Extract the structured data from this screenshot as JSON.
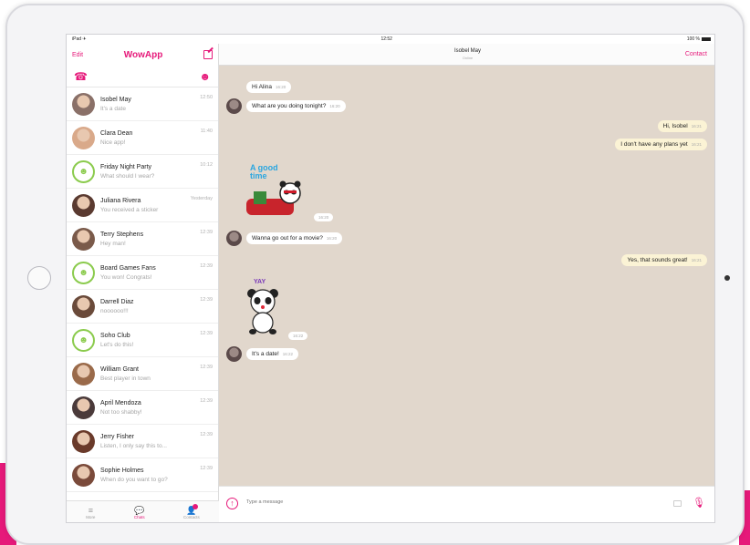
{
  "statusbar": {
    "carrier": "iPad ✈",
    "time": "12:52",
    "battery": "100 %"
  },
  "sidebar": {
    "edit_label": "Edit",
    "app_title": "WowApp",
    "chats": [
      {
        "name": "Isobel May",
        "preview": "It's a date",
        "time": "12:50",
        "avatar_color": "#8a7068",
        "group": false
      },
      {
        "name": "Clara Dean",
        "preview": "Nice app!",
        "time": "11:40",
        "avatar_color": "#d9a98a",
        "group": false
      },
      {
        "name": "Friday Night Party",
        "preview": "What should I wear?",
        "time": "10:12",
        "avatar_color": "#8bcb4d",
        "group": true
      },
      {
        "name": "Juliana Rivera",
        "preview": "You received a sticker",
        "time": "Yesterday",
        "avatar_color": "#5a3a30",
        "group": false
      },
      {
        "name": "Terry Stephens",
        "preview": "Hey man!",
        "time": "12:39",
        "avatar_color": "#7a5a4a",
        "group": false
      },
      {
        "name": "Board Games Fans",
        "preview": "You won! Congrats!",
        "time": "12:39",
        "avatar_color": "#8bcb4d",
        "group": true
      },
      {
        "name": "Darrell Diaz",
        "preview": "noooooo!!!",
        "time": "12:39",
        "avatar_color": "#6a4a3a",
        "group": false
      },
      {
        "name": "Soho Club",
        "preview": "Let's do this!",
        "time": "12:39",
        "avatar_color": "#8bcb4d",
        "group": true
      },
      {
        "name": "William Grant",
        "preview": "Best player in town",
        "time": "12:39",
        "avatar_color": "#9a6a4a",
        "group": false
      },
      {
        "name": "April Mendoza",
        "preview": "Not too shabby!",
        "time": "12:39",
        "avatar_color": "#4a3a3a",
        "group": false
      },
      {
        "name": "Jerry Fisher",
        "preview": "Listen, I only say this to...",
        "time": "12:39",
        "avatar_color": "#6a3a2a",
        "group": false
      },
      {
        "name": "Sophie Holmes",
        "preview": "When do you want to go?",
        "time": "12:39",
        "avatar_color": "#7a4a3a",
        "group": false
      }
    ],
    "tabs": [
      {
        "label": "More",
        "icon": "menu-icon"
      },
      {
        "label": "Chats",
        "icon": "chat-bubbles-icon"
      },
      {
        "label": "Contacts",
        "icon": "contacts-icon"
      }
    ]
  },
  "conversation": {
    "title": "Isobel May",
    "subtitle": "Online",
    "contact_label": "Contact",
    "messages": {
      "m1": {
        "text": "Hi Alina",
        "time": "16:20"
      },
      "m2": {
        "text": "What are you doing tonight?",
        "time": "16:20"
      },
      "m3": {
        "text": "Hi, Isobel",
        "time": "16:21"
      },
      "m4": {
        "text": "I don't have any plans yet",
        "time": "16:21"
      },
      "s1": {
        "caption": "A good time",
        "time": "16:20"
      },
      "m5": {
        "text": "Wanna go out for a movie?",
        "time": "16:20"
      },
      "m6": {
        "text": "Yes, that sounds great!",
        "time": "16:21"
      },
      "s2": {
        "caption": "YAY",
        "time": "16:22"
      },
      "m7": {
        "text": "It's a date!",
        "time": "16:22"
      }
    },
    "input_placeholder": "Type a message"
  },
  "colors": {
    "accent": "#e6197a",
    "chat_bg": "#e1d7cc",
    "outgoing_bubble": "#fbf3d5",
    "group_green": "#8bcb4d"
  }
}
